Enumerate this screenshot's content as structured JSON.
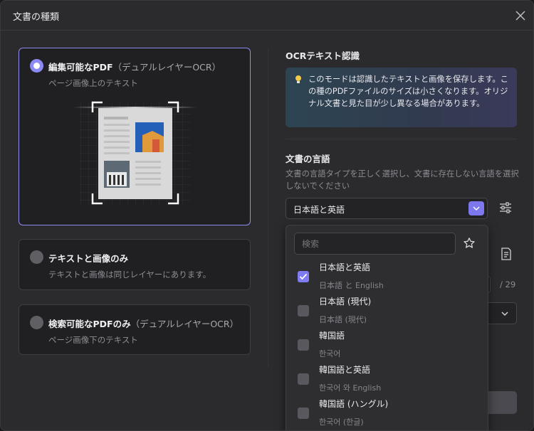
{
  "dialog": {
    "title": "文書の種類"
  },
  "modes": [
    {
      "title": "編集可能なPDF",
      "title_sub": "（デュアルレイヤーOCR）",
      "desc": "ページ画像上のテキスト",
      "selected": true
    },
    {
      "title": "テキストと画像のみ",
      "title_sub": "",
      "desc": "テキストと画像は同じレイヤーにあります。",
      "selected": false
    },
    {
      "title": "検索可能なPDFのみ",
      "title_sub": "（デュアルレイヤーOCR）",
      "desc": "ページ画像下のテキスト",
      "selected": false
    }
  ],
  "ocr": {
    "heading": "OCRテキスト認識",
    "info": "このモードは認識したテキストと画像を保存します。この種のPDFファイルのサイズは小さくなります。オリジナル文書と見た目が少し異なる場合があります。"
  },
  "language": {
    "heading": "文書の言語",
    "desc": "文書の言語タイプを正しく選択し、文書に存在しない言語を選択しないでください",
    "selected": "日本語と英語"
  },
  "page_total": "/ 29",
  "dropdown": {
    "search_placeholder": "検索",
    "options": [
      {
        "label": "日本語と英語",
        "sub": "日本語 と English",
        "checked": true
      },
      {
        "label": "日本語 (現代)",
        "sub": "日本語 (現代)",
        "checked": false
      },
      {
        "label": "韓国語",
        "sub": "한국어",
        "checked": false
      },
      {
        "label": "韓国語と英語",
        "sub": "한국어 와 English",
        "checked": false
      },
      {
        "label": "韓国語 (ハングル)",
        "sub": "한국어 (한글)",
        "checked": false
      }
    ]
  },
  "colors": {
    "accent": "#8d8af5",
    "panel": "#2b2b2e",
    "card": "#202023"
  },
  "icons": [
    "close-icon",
    "radio-icon",
    "bulb-icon",
    "chevron-down-icon",
    "sliders-icon",
    "star-icon",
    "check-icon",
    "document-icon"
  ]
}
